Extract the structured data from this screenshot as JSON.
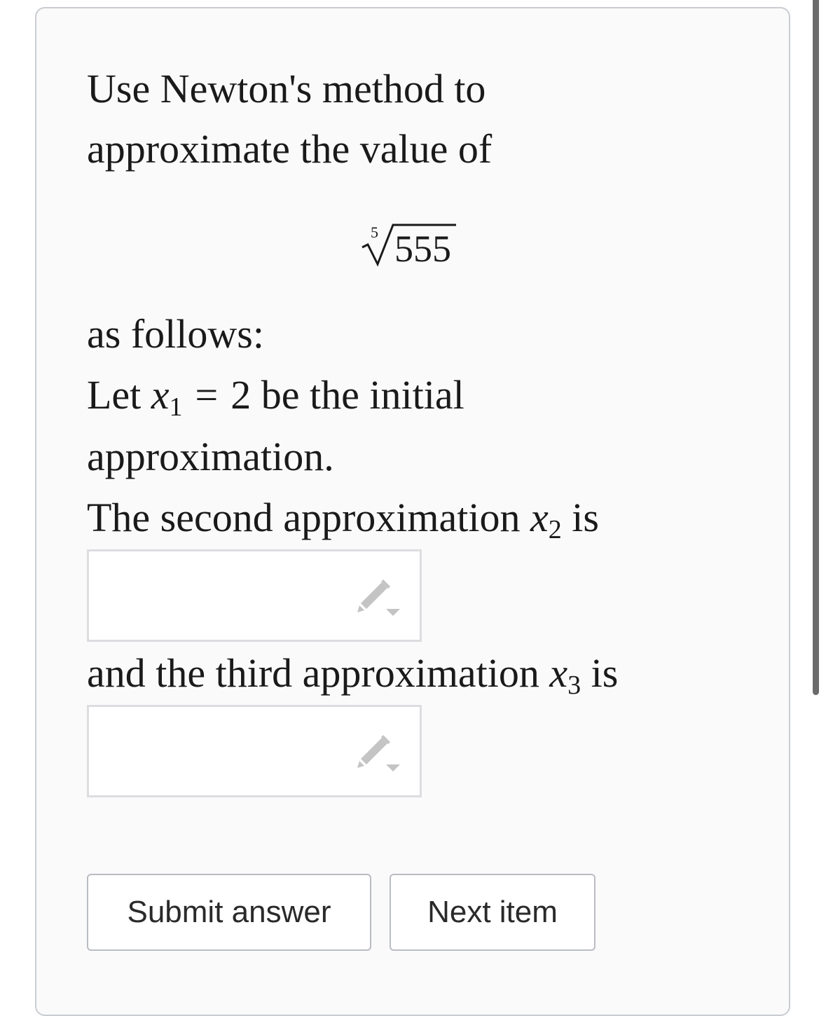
{
  "question": {
    "intro_line1": "Use Newton's method to",
    "intro_line2": "approximate the value of",
    "radical_index": "5",
    "radicand": "555",
    "as_follows": "as follows:",
    "let_prefix": "Let ",
    "x_var": "x",
    "sub_1": "1",
    "equals": "=",
    "initial_value": "2",
    "let_suffix": " be the initial",
    "approximation_word": "approximation.",
    "second_prefix": "The second approximation ",
    "sub_2": "2",
    "second_suffix": " is",
    "third_prefix": "and the third approximation ",
    "sub_3": "3",
    "third_suffix": " is"
  },
  "inputs": {
    "x2_value": "",
    "x3_value": ""
  },
  "icons": {
    "edit_icon": "pencil-dropdown-icon"
  },
  "buttons": {
    "submit_label": "Submit answer",
    "next_label": "Next item"
  }
}
